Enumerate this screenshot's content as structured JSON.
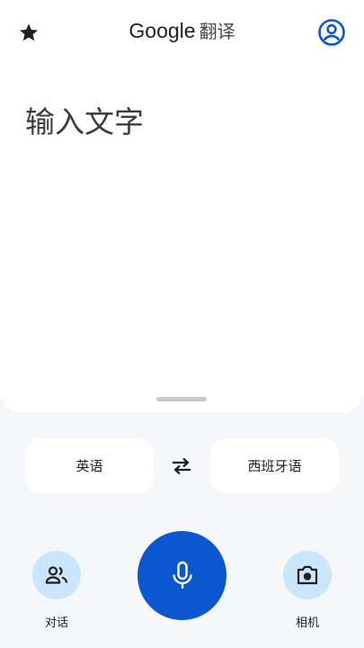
{
  "header": {
    "brand": "Google",
    "product": "翻译",
    "favorites_icon": "star-icon",
    "account_icon": "account-circle-icon"
  },
  "input": {
    "placeholder": "输入文字"
  },
  "languages": {
    "source": "英语",
    "target": "西班牙语",
    "swap_icon": "swap-arrows-icon"
  },
  "actions": {
    "conversation_label": "对话",
    "conversation_icon": "people-icon",
    "mic_icon": "mic-icon",
    "camera_label": "相机",
    "camera_icon": "camera-icon"
  },
  "colors": {
    "accent": "#0b57d0",
    "tonal": "#c9e6fc",
    "background": "#f5f7fb"
  }
}
